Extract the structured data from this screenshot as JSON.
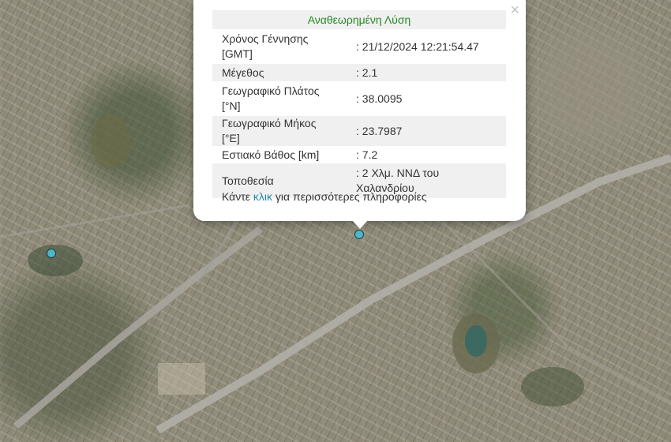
{
  "popup": {
    "title": "Αναθεωρημένη Λύση",
    "close_symbol": "×",
    "rows": [
      {
        "label": "Χρόνος Γέννησης [GMT]",
        "value": ": 21/12/2024 12:21:54.47"
      },
      {
        "label": "Μέγεθος",
        "value": ": 2.1"
      },
      {
        "label": "Γεωγραφικό Πλάτος [°N]",
        "value": ": 38.0095"
      },
      {
        "label": "Γεωγραφικό Μήκος [°E]",
        "value": ": 23.7987"
      },
      {
        "label": "Εστιακό Βάθος [km]",
        "value": ": 7.2"
      },
      {
        "label": "Τοποθεσία",
        "value": ": 2 Χλμ. ΝΝΔ του Χαλανδρίου"
      }
    ],
    "more_prefix": "Κάντε ",
    "more_link": "κλικ",
    "more_suffix": " για περισσότερες πληροφορίες"
  },
  "markers": [
    {
      "name": "selected-earthquake",
      "color": "#4fb8c8"
    },
    {
      "name": "other-earthquake",
      "color": "#4fb8c8"
    }
  ],
  "colors": {
    "title_green": "#248a24",
    "link": "#1f8aa8",
    "row_shade": "#f0f0f0"
  }
}
